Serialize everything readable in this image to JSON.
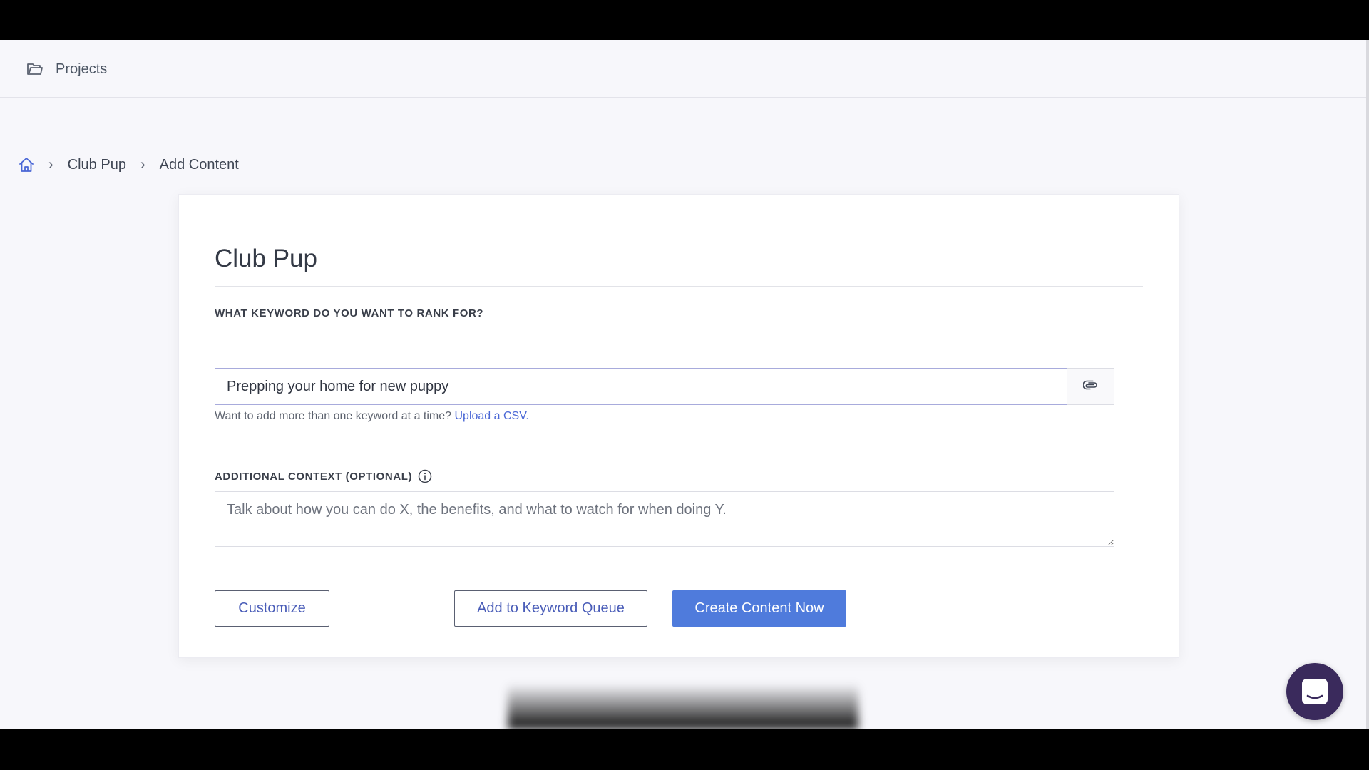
{
  "topbar": {
    "projects_label": "Projects",
    "projects_icon": "folder-icon"
  },
  "breadcrumb": {
    "home_icon": "home-icon",
    "separator": "›",
    "items": [
      "Club Pup",
      "Add Content"
    ]
  },
  "card": {
    "title": "Club Pup",
    "keyword_label": "WHAT KEYWORD DO YOU WANT TO RANK FOR?",
    "keyword_value": "Prepping your home for new puppy",
    "attach_icon": "paperclip-icon",
    "helper_text": "Want to add more than one keyword at a time?",
    "helper_link": "Upload a CSV.",
    "context_label": "ADDITIONAL CONTEXT (OPTIONAL)",
    "context_info_icon": "info-icon",
    "context_placeholder": "Talk about how you can do X, the benefits, and what to watch for when doing Y.",
    "context_value": ""
  },
  "actions": {
    "customize_label": "Customize",
    "queue_label": "Add to Keyword Queue",
    "create_label": "Create Content Now"
  },
  "chat": {
    "icon": "chat-icon"
  },
  "colors": {
    "accent": "#4f7bdc",
    "link": "#4a67d6",
    "chat_launcher": "#3a2a5c",
    "background": "#f7f7fb"
  }
}
